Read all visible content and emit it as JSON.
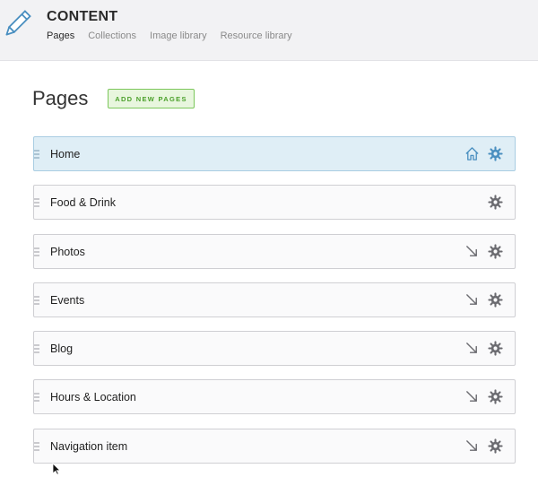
{
  "header": {
    "app_title": "CONTENT",
    "nav": [
      "Pages",
      "Collections",
      "Image library",
      "Resource library"
    ],
    "active_nav": "Pages"
  },
  "main": {
    "heading": "Pages",
    "add_button_label": "ADD NEW PAGES",
    "rows": [
      {
        "label": "Home",
        "selected": true,
        "side_icon": "home-icon"
      },
      {
        "label": "Food & Drink",
        "selected": false,
        "side_icon": null
      },
      {
        "label": "Photos",
        "selected": false,
        "side_icon": "arrow-down-right-icon"
      },
      {
        "label": "Events",
        "selected": false,
        "side_icon": "arrow-down-right-icon"
      },
      {
        "label": "Blog",
        "selected": false,
        "side_icon": "arrow-down-right-icon"
      },
      {
        "label": "Hours & Location",
        "selected": false,
        "side_icon": "arrow-down-right-icon"
      },
      {
        "label": "Navigation item",
        "selected": false,
        "side_icon": "arrow-down-right-icon"
      }
    ]
  },
  "colors": {
    "selected_row_bg": "#dfeef6",
    "selected_row_border": "#a9cde2",
    "accent_blue": "#4a8fc0",
    "add_button_green": "#4aa02a"
  }
}
